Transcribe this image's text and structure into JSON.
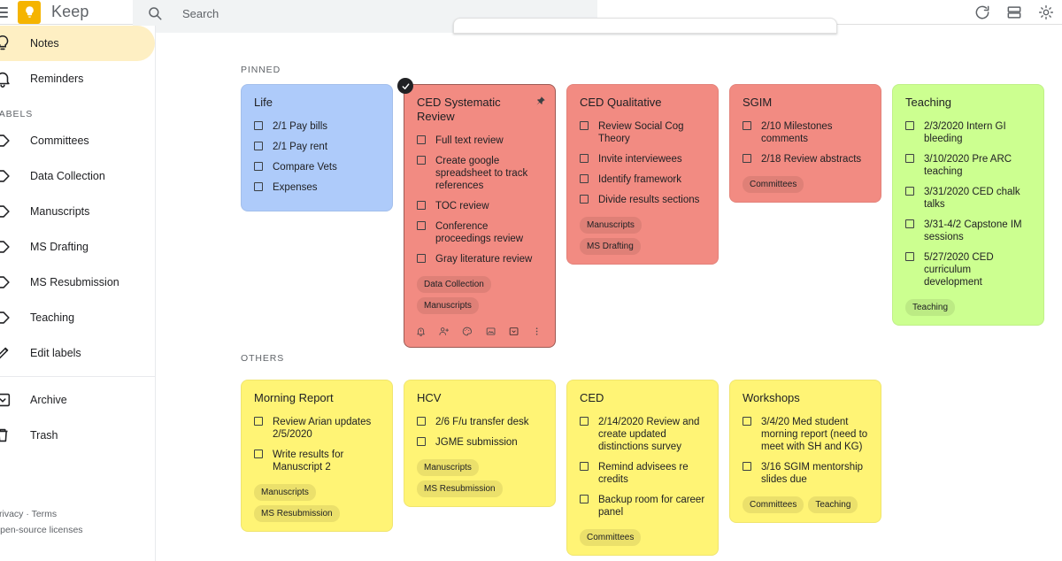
{
  "header": {
    "brand": "Keep",
    "menu_icon": "hamburger-menu-icon",
    "logo_icon": "keep-bulb-logo",
    "search": {
      "placeholder": "Search",
      "value": "",
      "icon": "search-icon"
    },
    "actions": [
      {
        "name": "refresh-button",
        "icon": "refresh-icon"
      },
      {
        "name": "list-view-button",
        "icon": "list-view-icon"
      },
      {
        "name": "settings-button",
        "icon": "gear-icon"
      }
    ]
  },
  "sidebar": {
    "primary": [
      {
        "label": "Notes",
        "icon": "lightbulb-icon",
        "active": true
      },
      {
        "label": "Reminders",
        "icon": "bell-icon",
        "active": false
      }
    ],
    "labels_heading": "LABELS",
    "labels": [
      {
        "label": "Committees",
        "icon": "label-icon"
      },
      {
        "label": "Data Collection",
        "icon": "label-icon"
      },
      {
        "label": "Manuscripts",
        "icon": "label-icon"
      },
      {
        "label": "MS Drafting",
        "icon": "label-icon"
      },
      {
        "label": "MS Resubmission",
        "icon": "label-icon"
      },
      {
        "label": "Teaching",
        "icon": "label-icon"
      }
    ],
    "edit_labels": {
      "label": "Edit labels",
      "icon": "pencil-icon"
    },
    "bottom": [
      {
        "label": "Archive",
        "icon": "archive-icon"
      },
      {
        "label": "Trash",
        "icon": "trash-icon"
      }
    ],
    "footer": {
      "privacy": "Privacy",
      "separator": "·",
      "terms": "Terms",
      "licenses": "Open-source licenses"
    }
  },
  "colors": {
    "blue": "#aecbfa",
    "red": "#f28b82",
    "green": "#ccff90",
    "yellow": "#fff475",
    "accent": "#f5b400"
  },
  "main": {
    "pinned_heading": "PINNED",
    "others_heading": "OTHERS",
    "pinned": [
      {
        "title": "Life",
        "color": "#aecbfa",
        "pinned": false,
        "selected": false,
        "toolbar": false,
        "items": [
          "2/1 Pay bills",
          "2/1 Pay rent",
          "Compare Vets",
          "Expenses"
        ],
        "chips": []
      },
      {
        "title": "CED Systematic Review",
        "color": "#f28b82",
        "pinned": true,
        "selected": true,
        "toolbar": true,
        "items": [
          "Full text review",
          "Create google spreadsheet to track references",
          "TOC review",
          "Conference proceedings review",
          "Gray literature review"
        ],
        "chips": [
          "Data Collection",
          "Manuscripts"
        ]
      },
      {
        "title": "CED Qualitative",
        "color": "#f28b82",
        "pinned": false,
        "selected": false,
        "toolbar": false,
        "items": [
          "Review Social Cog Theory",
          "Invite interviewees",
          "Identify framework",
          "Divide results sections"
        ],
        "chips": [
          "Manuscripts",
          "MS Drafting"
        ]
      },
      {
        "title": "SGIM",
        "color": "#f28b82",
        "pinned": false,
        "selected": false,
        "toolbar": false,
        "items": [
          "2/10 Milestones comments",
          "2/18 Review abstracts"
        ],
        "chips": [
          "Committees"
        ]
      },
      {
        "title": "Teaching",
        "color": "#ccff90",
        "pinned": false,
        "selected": false,
        "toolbar": false,
        "items": [
          "2/3/2020 Intern GI bleeding",
          "3/10/2020 Pre ARC teaching",
          "3/31/2020 CED chalk talks",
          "3/31-4/2 Capstone IM sessions",
          "5/27/2020 CED curriculum development"
        ],
        "chips": [
          "Teaching"
        ]
      }
    ],
    "others": [
      {
        "title": "Morning Report",
        "color": "#fff475",
        "pinned": false,
        "selected": false,
        "toolbar": false,
        "items": [
          "Review Arian updates 2/5/2020",
          "Write results for Manuscript 2"
        ],
        "chips": [
          "Manuscripts",
          "MS Resubmission"
        ]
      },
      {
        "title": "HCV",
        "color": "#fff475",
        "pinned": false,
        "selected": false,
        "toolbar": false,
        "items": [
          "2/6 F/u transfer desk",
          "JGME submission"
        ],
        "chips": [
          "Manuscripts",
          "MS Resubmission"
        ]
      },
      {
        "title": "CED",
        "color": "#fff475",
        "pinned": false,
        "selected": false,
        "toolbar": false,
        "items": [
          "2/14/2020 Review and create updated distinctions survey",
          "Remind advisees re credits",
          "Backup room for career panel"
        ],
        "chips": [
          "Committees"
        ]
      },
      {
        "title": "Workshops",
        "color": "#fff475",
        "pinned": false,
        "selected": false,
        "toolbar": false,
        "items": [
          "3/4/20 Med student morning report (need to meet with SH and KG)",
          "3/16 SGIM mentorship slides due"
        ],
        "chips": [
          "Committees",
          "Teaching"
        ]
      }
    ],
    "note_toolbar_icons": [
      "reminder-bell-icon",
      "add-collaborator-icon",
      "color-palette-icon",
      "add-image-icon",
      "archive-icon",
      "more-options-icon"
    ]
  }
}
